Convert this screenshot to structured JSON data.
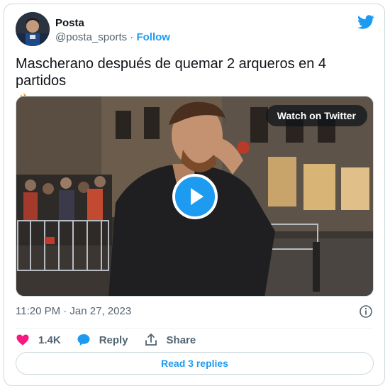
{
  "author": {
    "name": "Posta",
    "handle": "@posta_sports",
    "separator": "·",
    "follow_label": "Follow"
  },
  "tweet": {
    "text": "Mascherano después de quemar 2 arqueros en 4 partidos",
    "emoji": "fire-emoji"
  },
  "media": {
    "watch_label": "Watch on Twitter",
    "play_icon": "play-icon"
  },
  "meta": {
    "timestamp": "11:20 PM · Jan 27, 2023",
    "info_icon": "info-icon"
  },
  "actions": {
    "like_count": "1.4K",
    "reply_label": "Reply",
    "share_label": "Share"
  },
  "footer": {
    "read_replies_label": "Read 3 replies"
  },
  "colors": {
    "accent": "#1d9bf0",
    "like": "#f91880",
    "muted": "#536471"
  }
}
